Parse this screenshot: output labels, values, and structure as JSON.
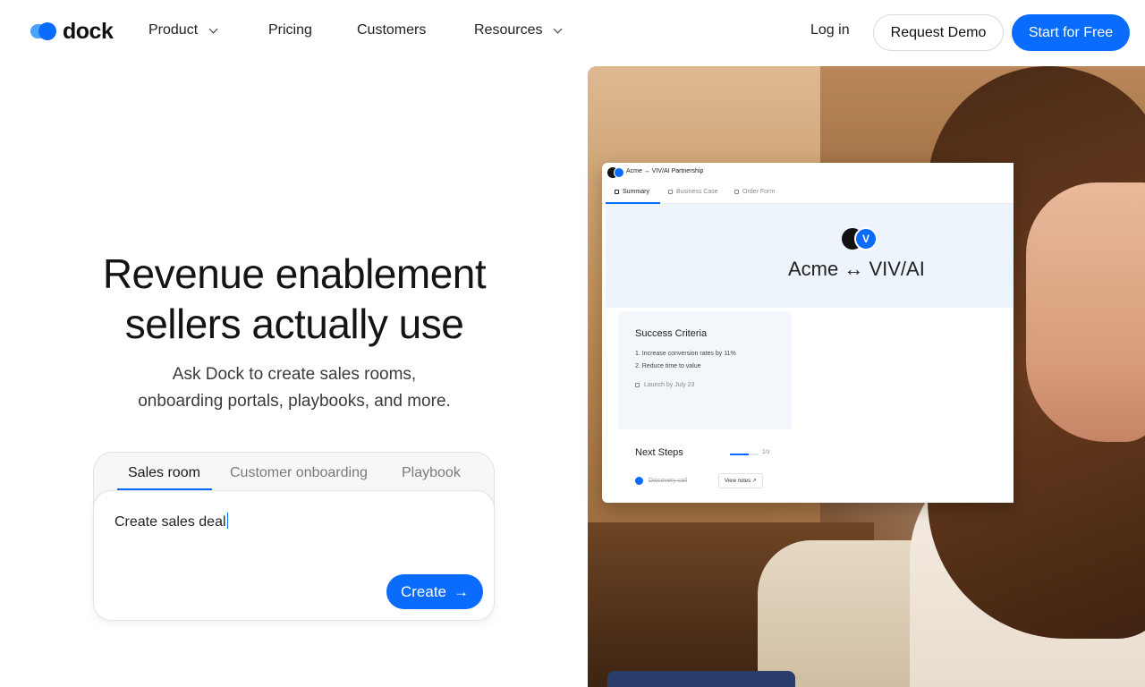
{
  "brand": {
    "name": "dock"
  },
  "nav": {
    "items": [
      {
        "label": "Product",
        "has_dropdown": true
      },
      {
        "label": "Pricing",
        "has_dropdown": false
      },
      {
        "label": "Customers",
        "has_dropdown": false
      },
      {
        "label": "Resources",
        "has_dropdown": true
      }
    ],
    "login": "Log in",
    "request_demo": "Request Demo",
    "start_free": "Start for Free"
  },
  "hero": {
    "headline_line1": "Revenue enablement",
    "headline_line2": "sellers actually use",
    "subhead_line1": "Ask Dock to create sales rooms,",
    "subhead_line2": "onboarding portals, playbooks, and more."
  },
  "composer": {
    "tabs": [
      "Sales room",
      "Customer onboarding",
      "Playbook"
    ],
    "active_tab": "Sales room",
    "input_value": "Create sales deal",
    "create_label": "Create"
  },
  "app_preview": {
    "title": "Acme ↔ VIV/AI Partnership",
    "tabs": [
      "Summary",
      "Business Case",
      "Order Form"
    ],
    "active_tab": "Summary",
    "banner_logo_letter": "V",
    "banner_title": "Acme ↔ VIV/AI",
    "success_criteria": {
      "title": "Success Criteria",
      "items": [
        "1. Increase conversion rates by 11%",
        "2. Reduce time to value"
      ],
      "launch": "Launch by July 23"
    },
    "next_steps": {
      "title": "Next Steps",
      "progress_label": "2/3",
      "progress_fraction": 0.66,
      "step1": "Discovery call",
      "step1_button": "View notes ↗"
    }
  },
  "colors": {
    "accent": "#0a6cff",
    "text": "#141414"
  }
}
